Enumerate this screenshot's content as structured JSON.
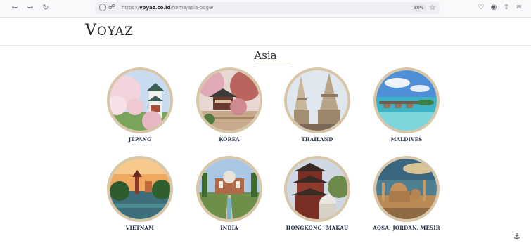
{
  "browser": {
    "url_prefix": "https://",
    "url_domain": "voyaz.co.id",
    "url_path": "/home/asia-page/",
    "zoom": "80%",
    "icons": [
      "back-icon",
      "forward-icon",
      "reload-icon",
      "shield-icon",
      "lock-icon",
      "star-icon",
      "pocket-icon",
      "account-icon",
      "extensions-icon",
      "menu-icon"
    ]
  },
  "site": {
    "logo": "VOYAZ",
    "logo_first": "V",
    "logo_rest": "OYAZ"
  },
  "page": {
    "title": "Asia"
  },
  "destinations": [
    {
      "label": "JEPANG"
    },
    {
      "label": "KOREA"
    },
    {
      "label": "THAILAND"
    },
    {
      "label": "MALDIVES"
    },
    {
      "label": "VIETNAM"
    },
    {
      "label": "INDIA"
    },
    {
      "label": "HONGKONG+MAKAU"
    },
    {
      "label": "AQSA, JORDAN, MESIR"
    }
  ],
  "colors": {
    "ring": "#d7c7a8",
    "caption": "#1d2a45"
  }
}
